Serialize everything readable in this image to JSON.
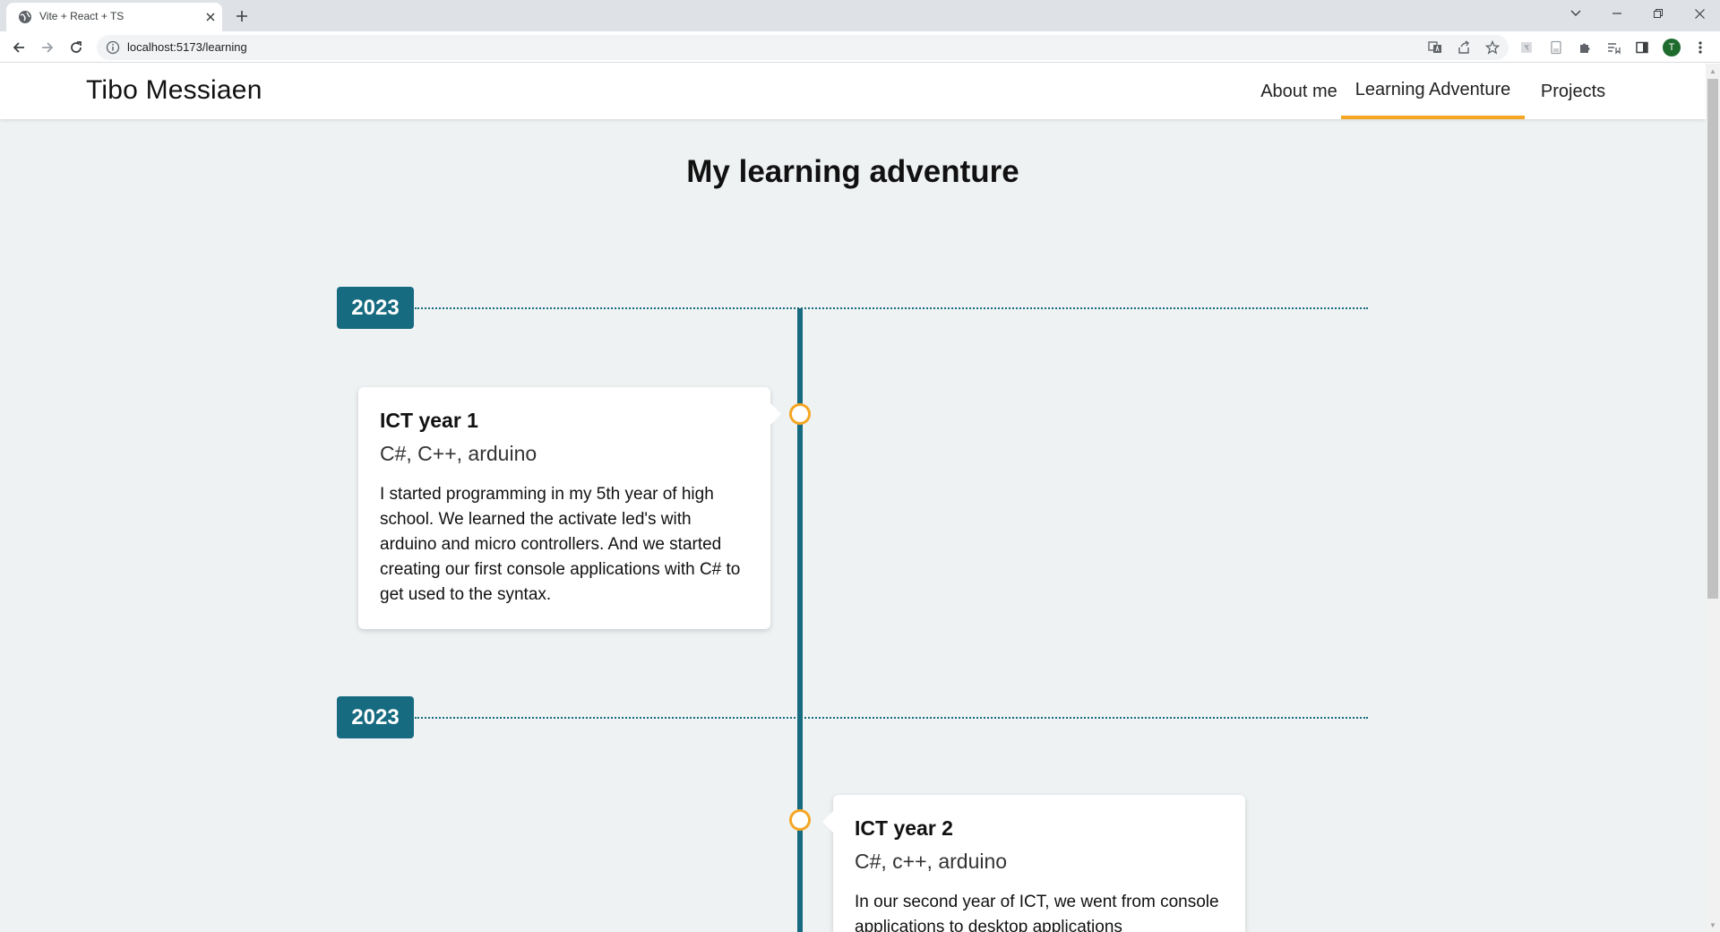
{
  "browser": {
    "tab_title": "Vite + React + TS",
    "url": "localhost:5173/learning",
    "avatar_letter": "T",
    "icons": [
      "globe-icon",
      "close-icon",
      "plus-icon",
      "back-arrow-icon",
      "forward-arrow-icon",
      "reload-icon",
      "info-icon",
      "translate-icon",
      "share-icon",
      "star-icon",
      "extension-icon",
      "puzzle-icon",
      "reading-list-icon",
      "side-panel-icon",
      "kebab-menu-icon"
    ]
  },
  "site": {
    "brand": "Tibo Messiaen",
    "nav": [
      "About me",
      "Learning Adventure",
      "Projects"
    ],
    "active_nav": "Learning Adventure",
    "accent_color": "#f5a623",
    "primary_color": "#176b80"
  },
  "page": {
    "title": "My learning adventure"
  },
  "timeline": [
    {
      "year": "2023",
      "title": "ICT year 1",
      "subtitle": "C#, C++, arduino",
      "body": "I started programming in my 5th year of high school. We learned the activate led's with arduino and micro controllers. And we started creating our first console applications with C# to get used to the syntax.",
      "side": "left"
    },
    {
      "year": "2023",
      "title": "ICT year 2",
      "subtitle": "C#, c++, arduino",
      "body": "In our second year of ICT, we went from console applications to desktop applications",
      "side": "right"
    }
  ]
}
